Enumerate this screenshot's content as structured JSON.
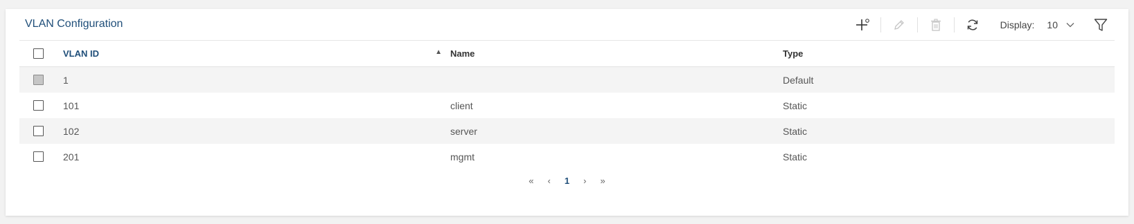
{
  "panel": {
    "title": "VLAN Configuration",
    "toolbar": {
      "add_icon": "add-icon",
      "edit_icon": "edit-icon",
      "delete_icon": "delete-icon",
      "refresh_icon": "refresh-icon",
      "display_label": "Display:",
      "display_value": "10",
      "filter_icon": "filter-icon"
    }
  },
  "table": {
    "columns": [
      "VLAN ID",
      "Name",
      "Type"
    ],
    "sort": "ascending",
    "rows": [
      {
        "vlan_id": "1",
        "name": "",
        "type": "Default",
        "selectable": false
      },
      {
        "vlan_id": "101",
        "name": "client",
        "type": "Static",
        "selectable": true
      },
      {
        "vlan_id": "102",
        "name": "server",
        "type": "Static",
        "selectable": true
      },
      {
        "vlan_id": "201",
        "name": "mgmt",
        "type": "Static",
        "selectable": true
      }
    ]
  },
  "pagination": {
    "first": "«",
    "prev": "‹",
    "current": "1",
    "next": "›",
    "last": "»"
  },
  "colors": {
    "accent": "#1f4e79",
    "row_stripe": "#f4f4f4",
    "background": "#f2f2f2"
  }
}
